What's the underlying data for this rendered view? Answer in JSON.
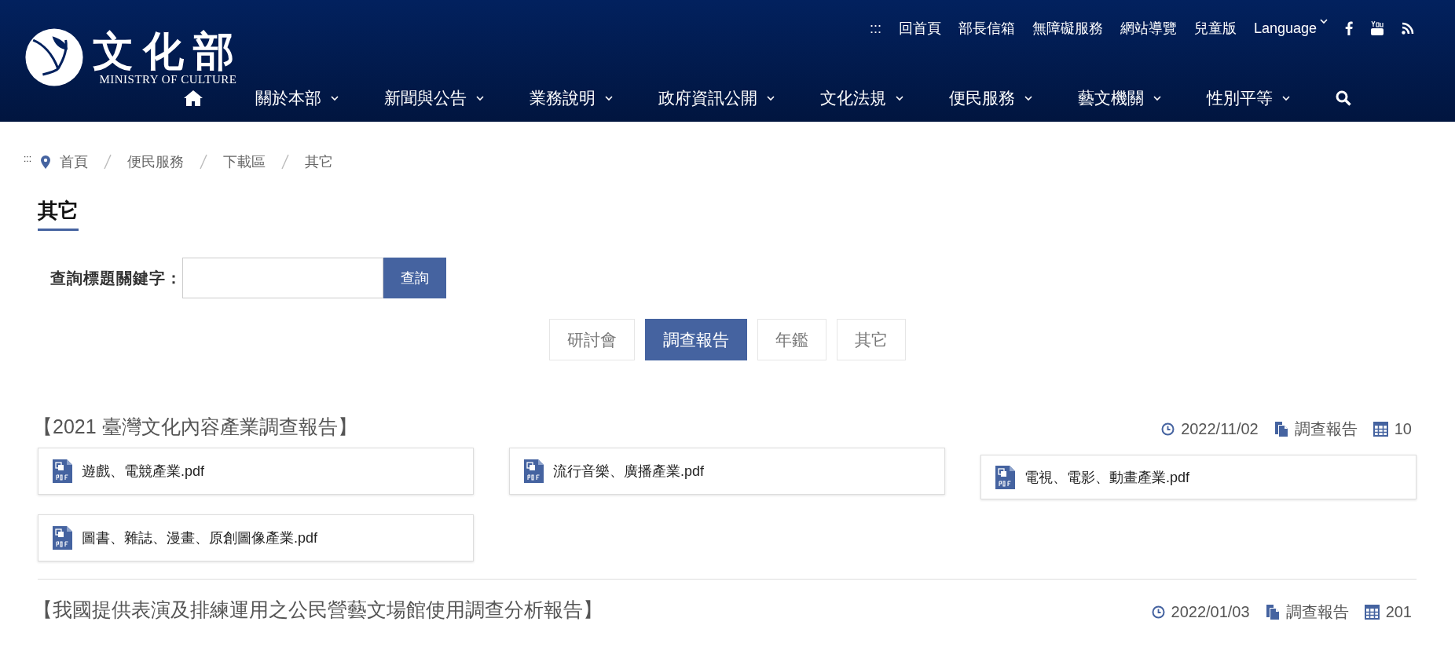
{
  "header": {
    "logo_title": "文化部",
    "logo_subtitle": "MINISTRY OF CULTURE",
    "top_links": [
      ":::",
      "回首頁",
      "部長信箱",
      "無障礙服務",
      "網站導覽",
      "兒童版"
    ],
    "language": "Language",
    "nav": [
      "關於本部",
      "新聞與公告",
      "業務說明",
      "政府資訊公開",
      "文化法規",
      "便民服務",
      "藝文機關",
      "性別平等"
    ]
  },
  "breadcrumb": {
    "marker": ":::",
    "items": [
      "首頁",
      "便民服務",
      "下載區",
      "其它"
    ]
  },
  "page_title": "其它",
  "search": {
    "label": "查詢標題關鍵字：",
    "button": "查詢"
  },
  "tabs": [
    {
      "label": "研討會",
      "selected": false
    },
    {
      "label": "調查報告",
      "selected": true
    },
    {
      "label": "年鑑",
      "selected": false
    },
    {
      "label": "其它",
      "selected": false
    }
  ],
  "groups": [
    {
      "title": "【2021 臺灣文化內容產業調查報告】",
      "date": "2022/11/02",
      "category": "調查報告",
      "count": "10",
      "files": [
        "遊戲、電競產業.pdf",
        "流行音樂、廣播產業.pdf",
        "電視、電影、動畫產業.pdf",
        "圖書、雜誌、漫畫、原創圖像產業.pdf"
      ]
    },
    {
      "title": "【我國提供表演及排練運用之公民營藝文場館使用調查分析報告】",
      "date": "2022/01/03",
      "category": "調查報告",
      "count": "201"
    }
  ]
}
